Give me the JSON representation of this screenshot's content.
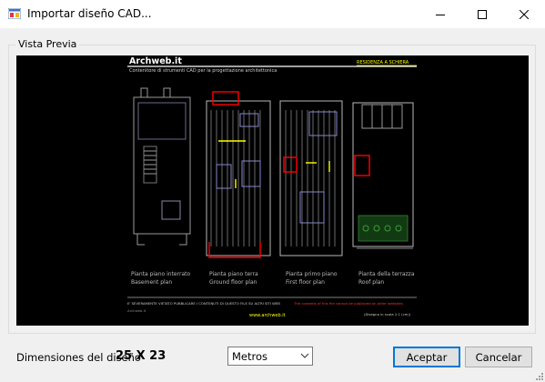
{
  "window": {
    "title": "Importar diseño CAD..."
  },
  "group": {
    "label": "Vista Previa"
  },
  "preview": {
    "brand": "Archweb.it",
    "subtitle": "Contenitore di strumenti CAD per la progettazione architettonica",
    "project": "RESIDENZA A SCHIERA",
    "plans": [
      {
        "it": "Pianta piano interrato",
        "en": "Basement plan"
      },
      {
        "it": "Pianta piano terra",
        "en": "Ground floor plan"
      },
      {
        "it": "Pianta primo piano",
        "en": "First floor plan"
      },
      {
        "it": "Pianta della terrazza",
        "en": "Roof plan"
      }
    ],
    "footer_left": "E' SEVERAMENTE VIETATO PUBBLICARE I CONTENUTI DI QUESTO FILE SU ALTRI SITI WEB",
    "footer_right": "The contents of this file cannot be published on other websites",
    "footer_url": "www.archweb.it",
    "footer_scale": "(Disegno in scala 1:1 (cm))",
    "footer_note": "Archweb.it"
  },
  "dimensions": {
    "label": "Dimensiones del diseño",
    "value": "25 X 23"
  },
  "units": {
    "selected": "Metros"
  },
  "buttons": {
    "accept": "Aceptar",
    "cancel": "Cancelar"
  },
  "colors": {
    "accent": "#0078d7",
    "cad_bg": "#000000",
    "cad_yellow": "#ffff00",
    "cad_red": "#ff0000"
  }
}
